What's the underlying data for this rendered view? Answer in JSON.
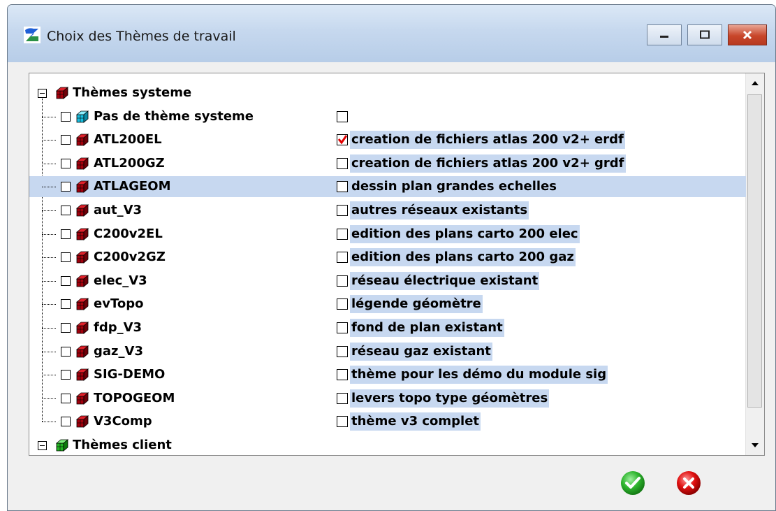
{
  "window": {
    "title": "Choix des Thèmes de travail"
  },
  "tree": {
    "system_group": {
      "label": "Thèmes systeme",
      "icon": "dark-red-cube-icon"
    },
    "client_group": {
      "label": "Thèmes client",
      "icon": "green-cube-icon"
    },
    "items": [
      {
        "label": "Pas de thème systeme",
        "description": "",
        "checked": false,
        "icon": "cyan-cube-icon"
      },
      {
        "label": "ATL200EL",
        "description": "creation de fichiers atlas 200 v2+ erdf",
        "checked": true,
        "icon": "red-cube-icon"
      },
      {
        "label": "ATL200GZ",
        "description": "creation de fichiers atlas 200 v2+ grdf",
        "checked": false,
        "icon": "red-cube-icon"
      },
      {
        "label": "ATLAGEOM",
        "description": "dessin plan grandes echelles",
        "checked": false,
        "icon": "red-cube-icon",
        "selected": true
      },
      {
        "label": "aut_V3",
        "description": "autres réseaux existants",
        "checked": false,
        "icon": "red-cube-icon"
      },
      {
        "label": "C200v2EL",
        "description": "edition des plans carto 200 elec",
        "checked": false,
        "icon": "red-cube-icon"
      },
      {
        "label": "C200v2GZ",
        "description": "edition des plans carto 200 gaz",
        "checked": false,
        "icon": "red-cube-icon"
      },
      {
        "label": "elec_V3",
        "description": "réseau électrique existant",
        "checked": false,
        "icon": "red-cube-icon"
      },
      {
        "label": "evTopo",
        "description": "légende géomètre",
        "checked": false,
        "icon": "red-cube-icon"
      },
      {
        "label": "fdp_V3",
        "description": "fond de plan existant",
        "checked": false,
        "icon": "red-cube-icon"
      },
      {
        "label": "gaz_V3",
        "description": "réseau gaz existant",
        "checked": false,
        "icon": "red-cube-icon"
      },
      {
        "label": "SIG-DEMO",
        "description": "thème pour les démo du module sig",
        "checked": false,
        "icon": "red-cube-icon"
      },
      {
        "label": "TOPOGEOM",
        "description": "levers topo type géomètres",
        "checked": false,
        "icon": "red-cube-icon"
      },
      {
        "label": "V3Comp",
        "description": "thème v3 complet",
        "checked": false,
        "icon": "red-cube-icon"
      }
    ]
  },
  "colors": {
    "selection": "#c7d8f0",
    "check_mark": "#e00000",
    "ok": "#2fb52f",
    "cancel": "#e01010"
  }
}
